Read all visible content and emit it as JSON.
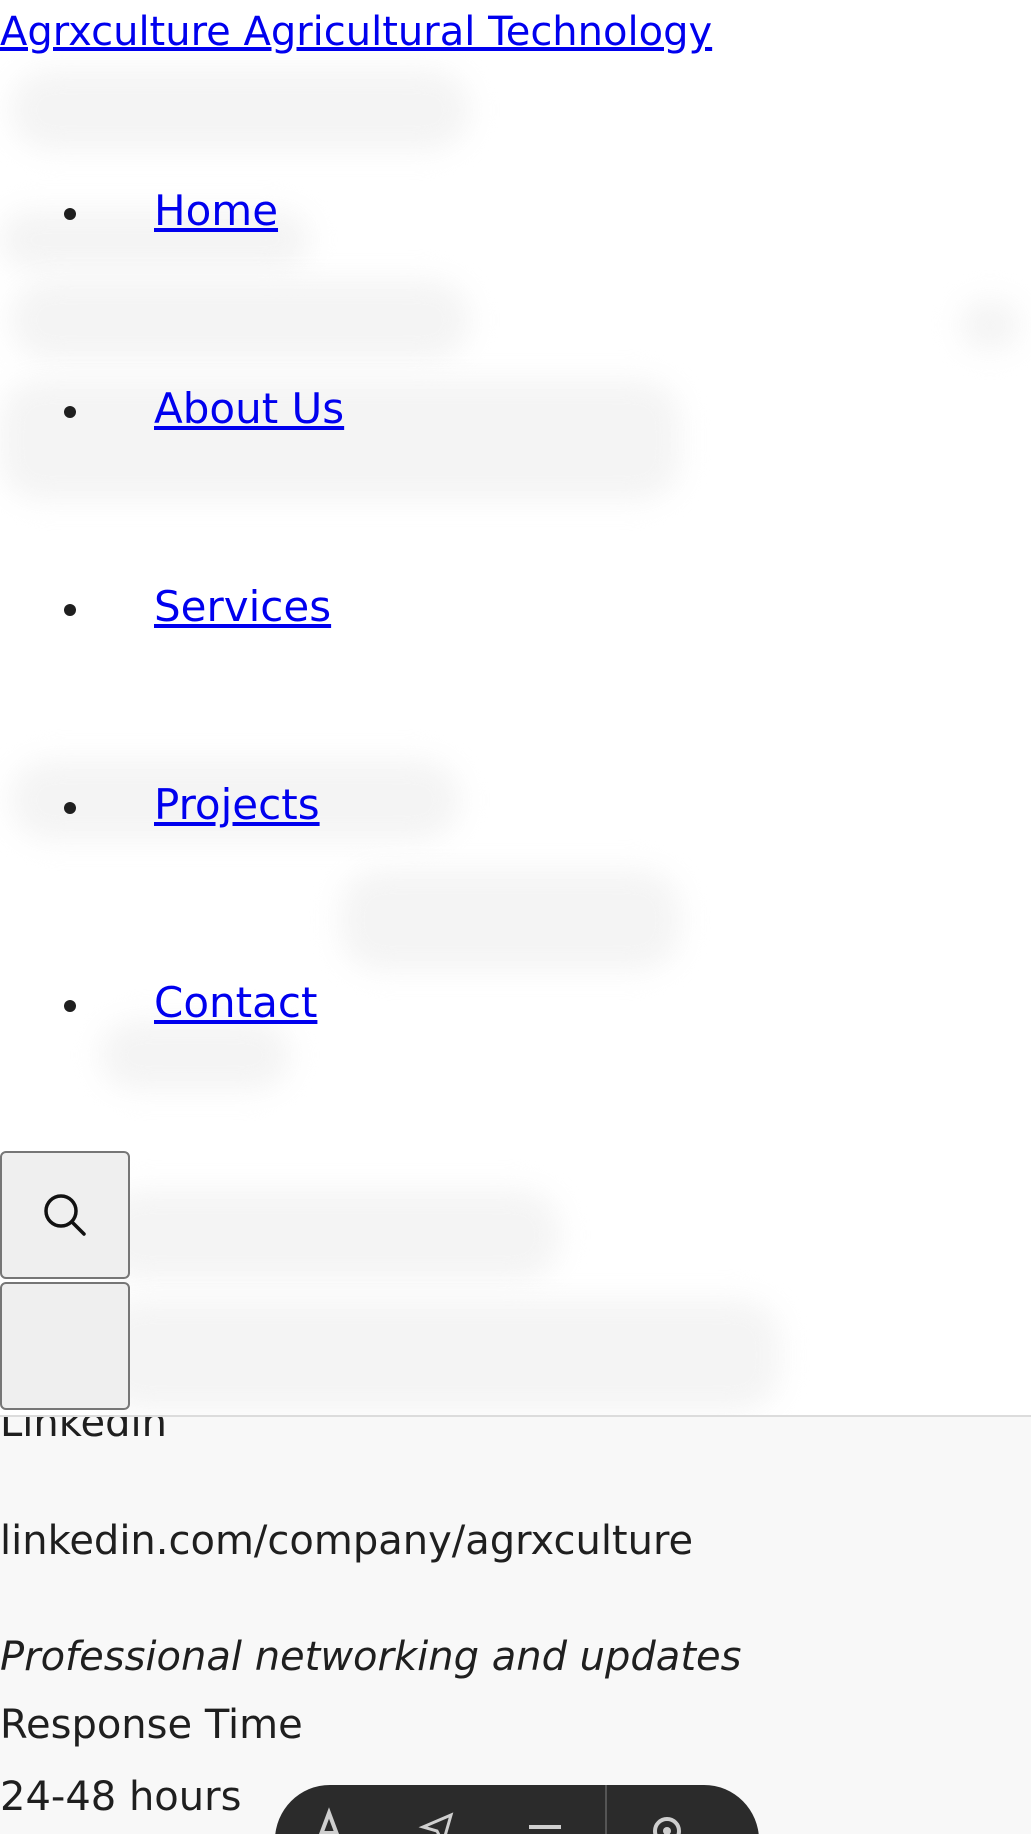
{
  "header": {
    "brand": "Agrxculture Agricultural Technology"
  },
  "nav": {
    "items": [
      {
        "label": "Home"
      },
      {
        "label": "About Us"
      },
      {
        "label": "Services"
      },
      {
        "label": "Projects"
      },
      {
        "label": "Contact"
      }
    ]
  },
  "buttons": {
    "search_icon": "search-icon",
    "menu_icon": "menu-icon"
  },
  "contact": {
    "linkedin_label": "Linkedin",
    "linkedin_url": "linkedin.com/company/agrxculture",
    "linkedin_note": "Professional networking and updates",
    "response_label": "Response Time",
    "response_value": "24-48 hours"
  },
  "toolbar": {
    "tools": [
      "text-icon",
      "send-icon",
      "line-icon",
      "settings-icon"
    ]
  }
}
